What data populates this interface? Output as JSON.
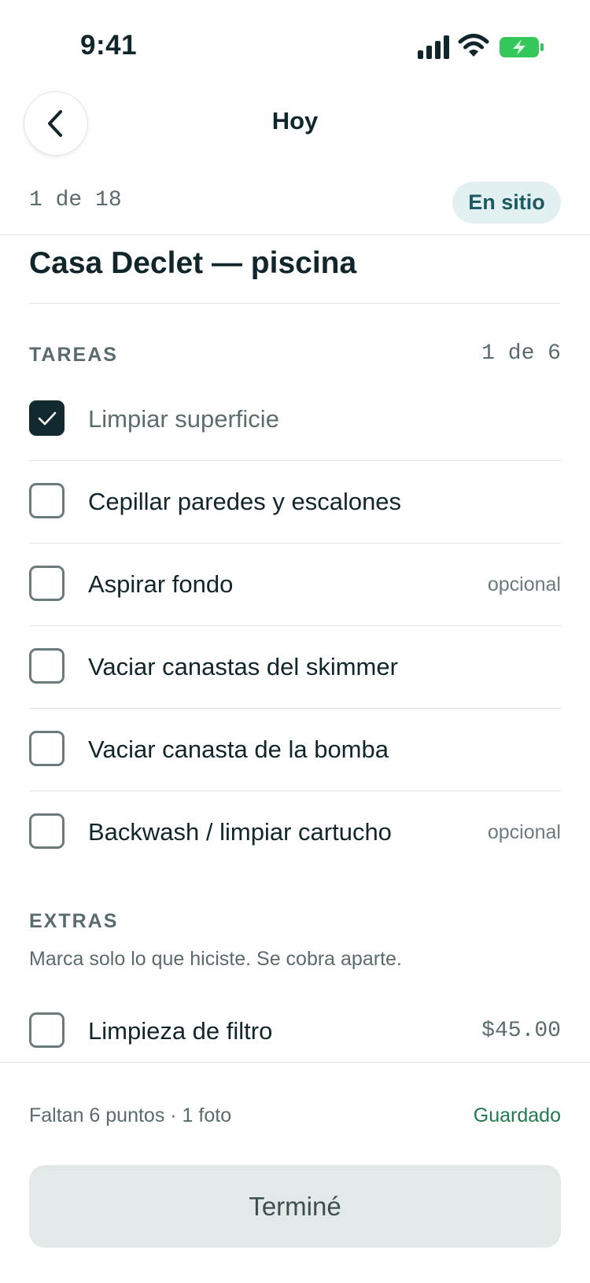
{
  "status_bar": {
    "time": "9:41",
    "icons": [
      "cellular-signal-icon",
      "wifi-icon",
      "battery-charging-icon"
    ],
    "battery_color": "#34c759"
  },
  "header": {
    "back_icon": "chevron-left-icon",
    "title": "Hoy"
  },
  "stop": {
    "counter": "1 de 18",
    "status_badge": "En sitio",
    "name": "Casa Declet — piscina"
  },
  "tasks": {
    "title": "TAREAS",
    "progress": "1 de 6",
    "items": [
      {
        "label": "Limpiar superficie",
        "checked": true,
        "tag": ""
      },
      {
        "label": "Cepillar paredes y escalones",
        "checked": false,
        "tag": ""
      },
      {
        "label": "Aspirar fondo",
        "checked": false,
        "tag": "opcional"
      },
      {
        "label": "Vaciar canastas del skimmer",
        "checked": false,
        "tag": ""
      },
      {
        "label": "Vaciar canasta de la bomba",
        "checked": false,
        "tag": ""
      },
      {
        "label": "Backwash / limpiar cartucho",
        "checked": false,
        "tag": "opcional"
      }
    ]
  },
  "extras": {
    "title": "EXTRAS",
    "description": "Marca solo lo que hiciste. Se cobra aparte.",
    "items": [
      {
        "label": "Limpieza de filtro",
        "checked": false,
        "price": "$45.00"
      }
    ]
  },
  "footer": {
    "pending": "Faltan 6 puntos · 1 foto",
    "saved": "Guardado",
    "done_button": "Terminé"
  },
  "colors": {
    "accent_dark": "#122a2f",
    "badge_bg": "#e3f0f1",
    "badge_text": "#1b5a60",
    "saved_green": "#1f7a52",
    "button_disabled_bg": "#e3e8e8"
  }
}
